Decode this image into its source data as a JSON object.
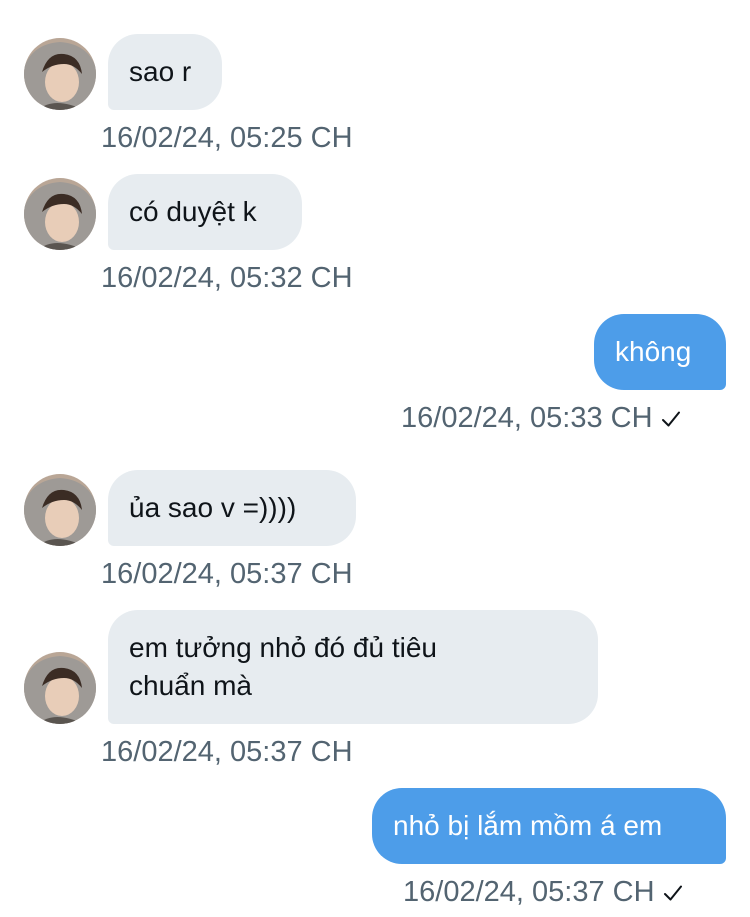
{
  "messages": [
    {
      "dir": "in",
      "text": "sao r",
      "time": "16/02/24, 05:25 CH"
    },
    {
      "dir": "in",
      "text": "có duyệt k",
      "time": "16/02/24, 05:32 CH"
    },
    {
      "dir": "out",
      "text": "không",
      "time": "16/02/24, 05:33 CH",
      "status_icon": "checkmark-icon"
    },
    {
      "dir": "in",
      "text": "ủa sao v =))))",
      "time": "16/02/24, 05:37 CH"
    },
    {
      "dir": "in",
      "text": "em tưởng nhỏ đó đủ tiêu\nchuẩn mà",
      "time": "16/02/24, 05:37 CH"
    },
    {
      "dir": "out",
      "text": "nhỏ bị lắm mồm á em",
      "time": "16/02/24, 05:37 CH",
      "status_icon": "checkmark-icon"
    }
  ],
  "colors": {
    "incoming_bubble": "#e7ecf0",
    "outgoing_bubble": "#4d9de9",
    "timestamp": "#536471"
  }
}
